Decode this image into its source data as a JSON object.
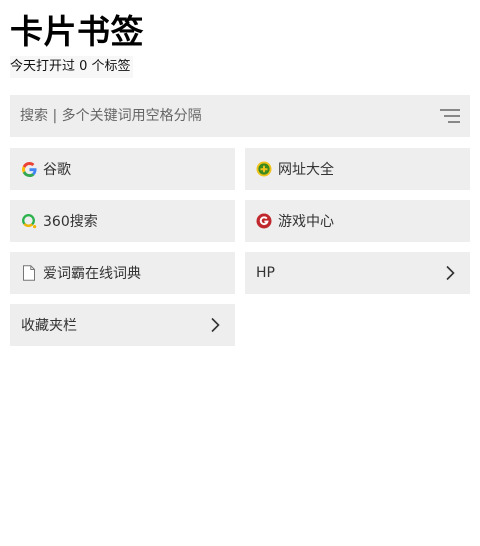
{
  "header": {
    "title": "卡片书签",
    "subtitle": "今天打开过 0 个标签"
  },
  "search": {
    "placeholder": "搜索 | 多个关键词用空格分隔",
    "value": ""
  },
  "bookmarks": [
    {
      "label": "谷歌",
      "icon": "google-icon"
    },
    {
      "label": "网址大全",
      "icon": "hao360-icon"
    },
    {
      "label": "360搜索",
      "icon": "so360-icon"
    },
    {
      "label": "游戏中心",
      "icon": "game-center-icon"
    },
    {
      "label": "爱词霸在线词典",
      "icon": "page-icon"
    }
  ],
  "folders": [
    {
      "label": "HP",
      "icon": "chevron-right-icon"
    },
    {
      "label": "收藏夹栏",
      "icon": "chevron-right-icon"
    }
  ],
  "colors": {
    "card_bg": "#eeeeee",
    "game_red": "#c0282d",
    "hao_green": "#3a8a1e",
    "hao_yellow": "#f3c21a"
  }
}
